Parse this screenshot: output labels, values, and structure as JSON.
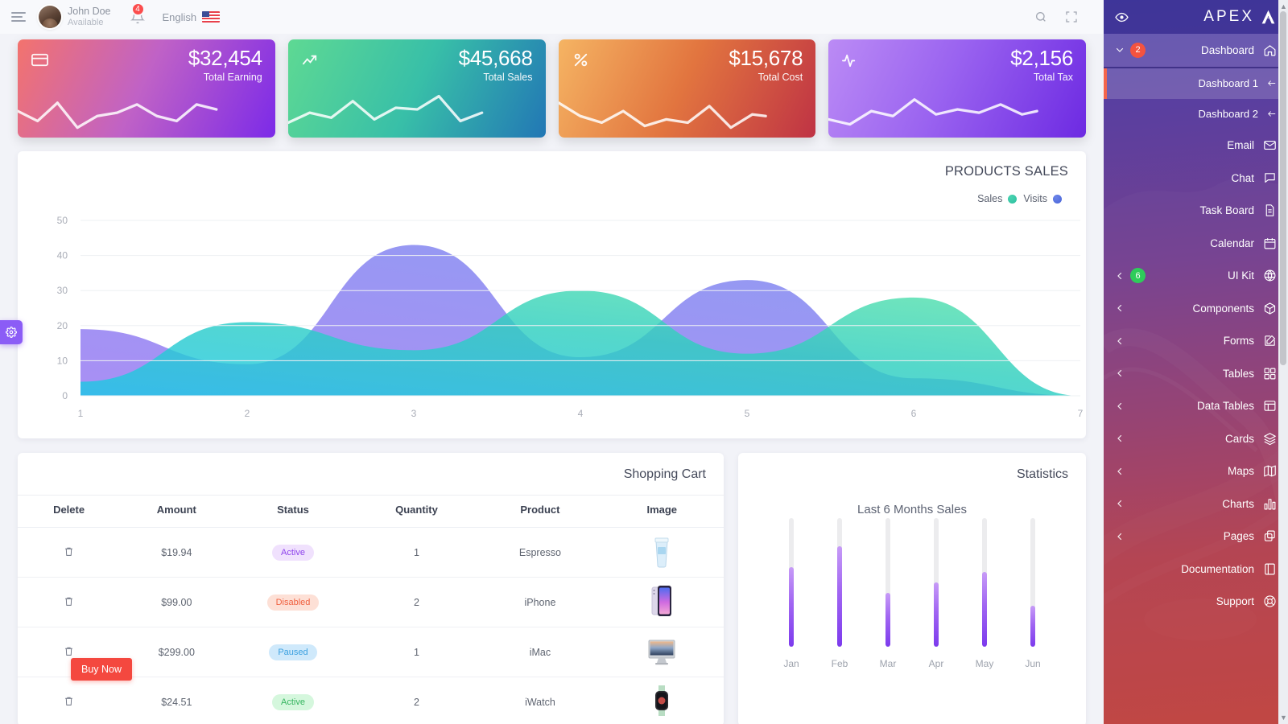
{
  "topbar": {
    "menu_icon": "hamburger-icon",
    "user_name": "John Doe",
    "user_status": "Available",
    "notification_count": "4",
    "language": "English",
    "search_icon": "search-icon",
    "fullscreen_icon": "fullscreen-icon"
  },
  "stat_cards": [
    {
      "icon": "credit-card-icon",
      "value": "$32,454",
      "label": "Total Earning"
    },
    {
      "icon": "trending-up-icon",
      "value": "$45,668",
      "label": "Total Sales"
    },
    {
      "icon": "percent-icon",
      "value": "$15,678",
      "label": "Total Cost"
    },
    {
      "icon": "activity-icon",
      "value": "$2,156",
      "label": "Total Tax"
    }
  ],
  "products_sales": {
    "title": "PRODUCTS SALES",
    "legend": [
      {
        "label": "Sales",
        "color": "#2bbfa0"
      },
      {
        "label": "Visits",
        "color": "#4864d8"
      }
    ]
  },
  "chart_data": [
    {
      "type": "area",
      "title": "PRODUCTS SALES",
      "xlabel": "",
      "ylabel": "",
      "x": [
        1,
        2,
        3,
        4,
        5,
        6,
        7
      ],
      "ylim": [
        0,
        50
      ],
      "xlim": [
        0,
        7
      ],
      "yticks": [
        0,
        10,
        20,
        30,
        40,
        50
      ],
      "xticks": [
        1,
        2,
        3,
        4,
        5,
        6,
        7
      ],
      "grid": true,
      "legend_position": "top-right",
      "series": [
        {
          "name": "Visits",
          "color": "#4864d8",
          "values": [
            19,
            9,
            43,
            11,
            33,
            5,
            0
          ]
        },
        {
          "name": "Sales",
          "color": "#2bbfa0",
          "values": [
            4,
            21,
            13,
            30,
            12,
            28,
            0
          ]
        }
      ]
    },
    {
      "type": "bar",
      "title": "Last 6 Months Sales",
      "categories": [
        "Jan",
        "Feb",
        "Mar",
        "Apr",
        "May",
        "Jun"
      ],
      "values": [
        62,
        78,
        42,
        50,
        58,
        32
      ],
      "ylim": [
        0,
        100
      ],
      "xlabel": "",
      "ylabel": "",
      "grid": false,
      "track_color": "#ececee",
      "fill_color": "#8b5cf6"
    }
  ],
  "cart": {
    "title": "Shopping Cart",
    "columns": [
      "Delete",
      "Amount",
      "Status",
      "Quantity",
      "Product",
      "Image"
    ],
    "rows": [
      {
        "delete_icon": "trash-icon",
        "amount": "$19.94",
        "status": "Active",
        "status_style": "b-active-p",
        "quantity": "1",
        "product": "Espresso",
        "image": "espresso-cup-thumbnail"
      },
      {
        "delete_icon": "trash-icon",
        "amount": "$99.00",
        "status": "Disabled",
        "status_style": "b-disabled",
        "quantity": "2",
        "product": "iPhone",
        "image": "iphone-thumbnail"
      },
      {
        "delete_icon": "trash-icon",
        "amount": "$299.00",
        "status": "Paused",
        "status_style": "b-paused",
        "quantity": "1",
        "product": "iMac",
        "image": "imac-thumbnail"
      },
      {
        "delete_icon": "trash-icon",
        "amount": "$24.51",
        "status": "Active",
        "status_style": "b-active-g",
        "quantity": "2",
        "product": "iWatch",
        "image": "iwatch-thumbnail"
      }
    ],
    "buy_now_label": "Buy Now"
  },
  "statistics": {
    "title": "Statistics",
    "subtitle": "Last 6 Months Sales"
  },
  "sidebar": {
    "eye_icon": "eye-icon",
    "brand": "APEX",
    "brand_mark": "apex-logo-icon",
    "items": [
      {
        "label": "Dashboard",
        "icon": "home-icon",
        "badge": "2",
        "badge_color": "#f4533f",
        "caret": "chevron-down-icon",
        "type": "parent"
      },
      {
        "label": "Dashboard 1",
        "icon": "arrow-left-icon",
        "type": "sub",
        "active": true
      },
      {
        "label": "Dashboard 2",
        "icon": "arrow-left-icon",
        "type": "sub",
        "active": false
      },
      {
        "label": "Email",
        "icon": "mail-icon",
        "type": "item"
      },
      {
        "label": "Chat",
        "icon": "chat-icon",
        "type": "item"
      },
      {
        "label": "Task Board",
        "icon": "file-icon",
        "type": "item"
      },
      {
        "label": "Calendar",
        "icon": "calendar-icon",
        "type": "item"
      },
      {
        "label": "UI Kit",
        "icon": "globe-icon",
        "badge": "6",
        "badge_color": "#2ecc5a",
        "caret": "chevron-left-icon",
        "type": "collapsible"
      },
      {
        "label": "Components",
        "icon": "box-icon",
        "caret": "chevron-left-icon",
        "type": "collapsible"
      },
      {
        "label": "Forms",
        "icon": "edit-icon",
        "caret": "chevron-left-icon",
        "type": "collapsible"
      },
      {
        "label": "Tables",
        "icon": "grid-icon",
        "caret": "chevron-left-icon",
        "type": "collapsible"
      },
      {
        "label": "Data Tables",
        "icon": "layout-icon",
        "caret": "chevron-left-icon",
        "type": "collapsible"
      },
      {
        "label": "Cards",
        "icon": "layers-icon",
        "caret": "chevron-left-icon",
        "type": "collapsible"
      },
      {
        "label": "Maps",
        "icon": "map-icon",
        "caret": "chevron-left-icon",
        "type": "collapsible"
      },
      {
        "label": "Charts",
        "icon": "bar-chart-icon",
        "caret": "chevron-left-icon",
        "type": "collapsible"
      },
      {
        "label": "Pages",
        "icon": "copy-icon",
        "caret": "chevron-left-icon",
        "type": "collapsible"
      },
      {
        "label": "Documentation",
        "icon": "book-icon",
        "type": "item"
      },
      {
        "label": "Support",
        "icon": "support-icon",
        "type": "item"
      }
    ]
  },
  "settings_tab": {
    "icon": "gear-icon"
  }
}
